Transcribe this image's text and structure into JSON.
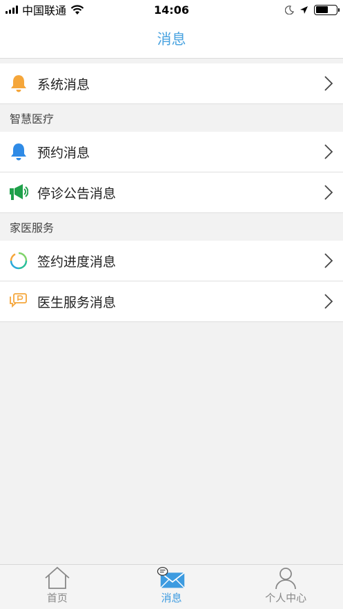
{
  "status_bar": {
    "carrier": "中国联通",
    "time": "14:06"
  },
  "nav": {
    "title": "消息"
  },
  "sections": {
    "system": {
      "items": [
        {
          "label": "系统消息",
          "icon": "bell-icon",
          "color": "#f5a63a"
        }
      ]
    },
    "smart_medical": {
      "header": "智慧医疗",
      "items": [
        {
          "label": "预约消息",
          "icon": "bell-icon",
          "color": "#2f8be6"
        },
        {
          "label": "停诊公告消息",
          "icon": "megaphone-icon",
          "color": "#1fa04a"
        }
      ]
    },
    "family_doctor": {
      "header": "家医服务",
      "items": [
        {
          "label": "签约进度消息",
          "icon": "progress-ring-icon",
          "color": "#2bbf9a"
        },
        {
          "label": "医生服务消息",
          "icon": "chat-bubble-icon",
          "color": "#f5a63a"
        }
      ]
    }
  },
  "tab_bar": {
    "items": [
      {
        "label": "首页",
        "icon": "home-icon",
        "active": false
      },
      {
        "label": "消息",
        "icon": "envelope-icon",
        "active": true
      },
      {
        "label": "个人中心",
        "icon": "person-icon",
        "active": false
      }
    ],
    "active_color": "#3d9be0",
    "inactive_color": "#888888"
  }
}
